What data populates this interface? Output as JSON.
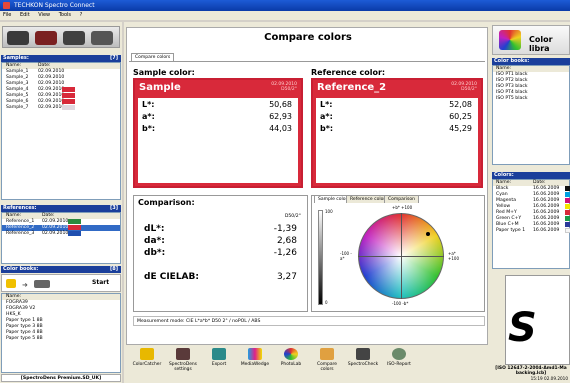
{
  "window": {
    "title": "TECHKON Spectro Connect"
  },
  "menu": [
    "File",
    "Edit",
    "View",
    "Tools",
    "?"
  ],
  "samples": {
    "header": "Samples:",
    "count": "[7]",
    "col_name": "Name:",
    "col_date": "Date:",
    "rows": [
      {
        "name": "Sample_1",
        "date": "02.09.2010",
        "color": ""
      },
      {
        "name": "Sample_2",
        "date": "02.09.2010",
        "color": ""
      },
      {
        "name": "Sample_3",
        "date": "02.09.2010",
        "color": ""
      },
      {
        "name": "Sample_4",
        "date": "02.09.2010",
        "color": "#d8293a"
      },
      {
        "name": "Sample_5",
        "date": "02.09.2010",
        "color": "#d8293a"
      },
      {
        "name": "Sample_6",
        "date": "02.09.2010",
        "color": "#d8293a"
      },
      {
        "name": "Sample_7",
        "date": "02.09.2010",
        "color": "#e0d8e0"
      }
    ]
  },
  "references": {
    "header": "References:",
    "count": "[3]",
    "col_name": "Name:",
    "col_date": "Date:",
    "rows": [
      {
        "name": "Reference_1",
        "date": "02.09.2010",
        "color": "#2b8a3e"
      },
      {
        "name": "Reference_2",
        "date": "02.09.2010",
        "color": "#d8293a",
        "selected": true
      },
      {
        "name": "Reference_3",
        "date": "02.09.2010",
        "color": "#1f4fb0"
      }
    ]
  },
  "colorbooks_left": {
    "header": "Color books:",
    "count": "[8]",
    "start_label": "Start",
    "col_name": "Name:",
    "rows": [
      "FOGRA39",
      "FOGRA39 V2",
      "HKS_K",
      "Paper type 1 8B",
      "Paper type 3 8B",
      "Paper type 4 8B",
      "Paper type 5 8B"
    ],
    "footer": "[SpectroDens Premium.SD_UK]"
  },
  "main": {
    "title": "Compare colors",
    "tab": "Compare colors",
    "sample": {
      "heading": "Sample color:",
      "name": "Sample",
      "date": "02.09.2010",
      "illum": "D50/2°",
      "L_label": "L*:",
      "a_label": "a*:",
      "b_label": "b*:",
      "L": "50,68",
      "a": "62,93",
      "b": "44,03"
    },
    "reference": {
      "heading": "Reference color:",
      "name": "Reference_2",
      "date": "02.09.2010",
      "illum": "D50/2°",
      "L_label": "L*:",
      "a_label": "a*:",
      "b_label": "b*:",
      "L": "52,08",
      "a": "60,25",
      "b": "45,29"
    },
    "comparison": {
      "heading": "Comparison:",
      "illum": "D50/2°",
      "dL_label": "dL*:",
      "da_label": "da*:",
      "db_label": "db*:",
      "de_label": "dE CIELAB:",
      "dL": "-1,39",
      "da": "2,68",
      "db": "-1,26",
      "de": "3,27"
    },
    "wheel_tabs": [
      "Sample color",
      "Reference color",
      "Comparison"
    ],
    "wheel_labels": {
      "top": "+b* +100",
      "bottom": "-100 -b*",
      "left": "-100 -a*",
      "right": "+a* +100",
      "l100": "100",
      "l0": "0"
    },
    "measurement": "Measurement mode: CIE L*a*b*      D50 2° / noPOL / ABS",
    "toolbar": [
      "ColorCatcher",
      "SpectroDens settings",
      "Export",
      "MediaWedge",
      "PhotoLab",
      "Compare colors",
      "SpectroCheck",
      "ISO-Report"
    ]
  },
  "right": {
    "library_title": "Color libra",
    "colorbooks": {
      "header": "Color books:",
      "col_name": "Name:",
      "rows": [
        "ISO PT1 black",
        "ISO PT2 black",
        "ISO PT3 black",
        "ISO PT4 black",
        "ISO PT5 black"
      ]
    },
    "colors": {
      "header": "Colors:",
      "col_name": "Name:",
      "col_date": "Date:",
      "rows": [
        {
          "name": "Black",
          "date": "16.06.2009",
          "color": "#111111"
        },
        {
          "name": "Cyan",
          "date": "16.06.2009",
          "color": "#00a0e0"
        },
        {
          "name": "Magenta",
          "date": "16.06.2009",
          "color": "#d0107a"
        },
        {
          "name": "Yellow",
          "date": "16.06.2009",
          "color": "#f3e600"
        },
        {
          "name": "Red M+Y",
          "date": "16.06.2009",
          "color": "#d8293a"
        },
        {
          "name": "Green C+Y",
          "date": "16.06.2009",
          "color": "#1a9a4a"
        },
        {
          "name": "Blue C+M",
          "date": "16.06.2009",
          "color": "#2a3a9a"
        },
        {
          "name": "Paper type 1",
          "date": "16.06.2009",
          "color": "#f6f6f6"
        }
      ]
    },
    "logo_text": "S",
    "footer": "[ISO 12647-2-2004-Amd1-Ma backing.lcb]",
    "status": "15:19  02.09.2010"
  }
}
